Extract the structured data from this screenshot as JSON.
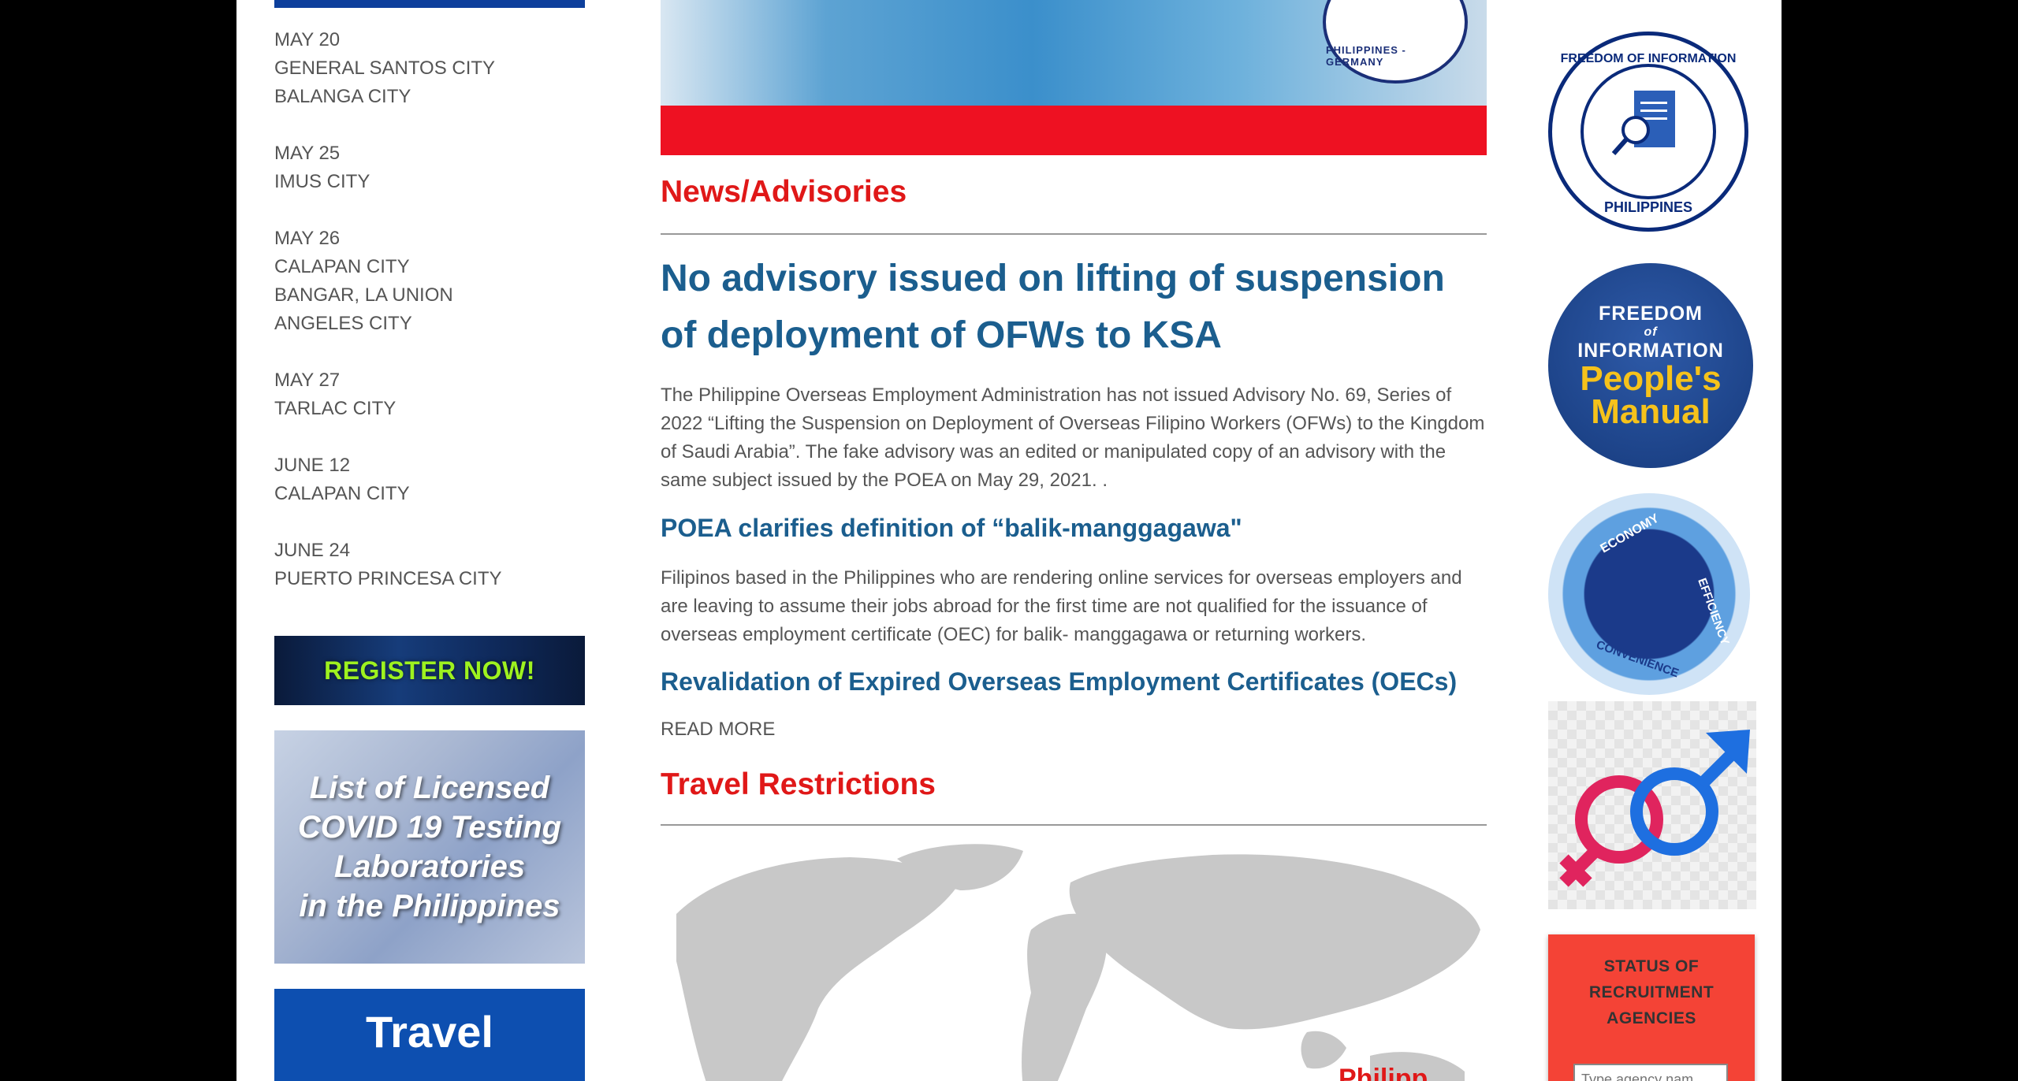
{
  "schedule": [
    {
      "date": "MAY 20",
      "cities": [
        "GENERAL SANTOS CITY",
        "BALANGA CITY"
      ]
    },
    {
      "date": "MAY 25",
      "cities": [
        "IMUS CITY"
      ]
    },
    {
      "date": "MAY 26",
      "cities": [
        "CALAPAN CITY",
        "BANGAR, LA UNION",
        "ANGELES CITY"
      ]
    },
    {
      "date": "MAY 27",
      "cities": [
        "TARLAC CITY"
      ]
    },
    {
      "date": "JUNE 12",
      "cities": [
        "CALAPAN CITY"
      ]
    },
    {
      "date": "JUNE 24",
      "cities": [
        "PUERTO PRINCESA CITY"
      ]
    }
  ],
  "banners": {
    "register": "REGISTER NOW!",
    "covid_lines": [
      "List of Licensed",
      "COVID 19 Testing",
      "Laboratories",
      "in the Philippines"
    ],
    "travel": "Travel"
  },
  "hero": {
    "seal_text": "PHILIPPINES - GERMANY"
  },
  "news": {
    "section_title": "News/Advisories",
    "headline": "No advisory issued on lifting of suspension of deployment of OFWs to KSA",
    "headline_body": "The Philippine Overseas Employment Administration has not issued Advisory No. 69, Series of 2022 “Lifting the Suspension on Deployment of Overseas Filipino Workers (OFWs) to the Kingdom of Saudi Arabia”. The fake advisory was an edited or manipulated copy of an advisory with the same subject issued by the POEA on May 29, 2021. .",
    "item2_title": "POEA clarifies definition of “balik-manggagawa\"",
    "item2_body": "Filipinos based in the Philippines who are rendering online services for overseas employers and are leaving to assume their jobs abroad for the first time are not qualified for the issuance of overseas employment certificate (OEC) for balik- manggagawa or returning workers.",
    "item3_title": "Revalidation of Expired Overseas Employment Certificates (OECs)",
    "read_more": "READ MORE"
  },
  "travel": {
    "section_title": "Travel Restrictions",
    "map_label": "Philipp"
  },
  "sidebar": {
    "foi_badge_top": "FREEDOM OF INFORMATION",
    "foi_badge_bottom": "PHILIPPINES",
    "manual_l1": "FREEDOM",
    "manual_l2": "of",
    "manual_l3": "INFORMATION",
    "manual_l4": "People's",
    "manual_l5": "Manual",
    "eco_words": [
      "ECONOMY",
      "EFFICIENCY",
      "CONVENIENCE"
    ],
    "status_title_lines": [
      "STATUS OF",
      "RECRUITMENT",
      "AGENCIES"
    ],
    "status_placeholder": "Type agency nam"
  }
}
